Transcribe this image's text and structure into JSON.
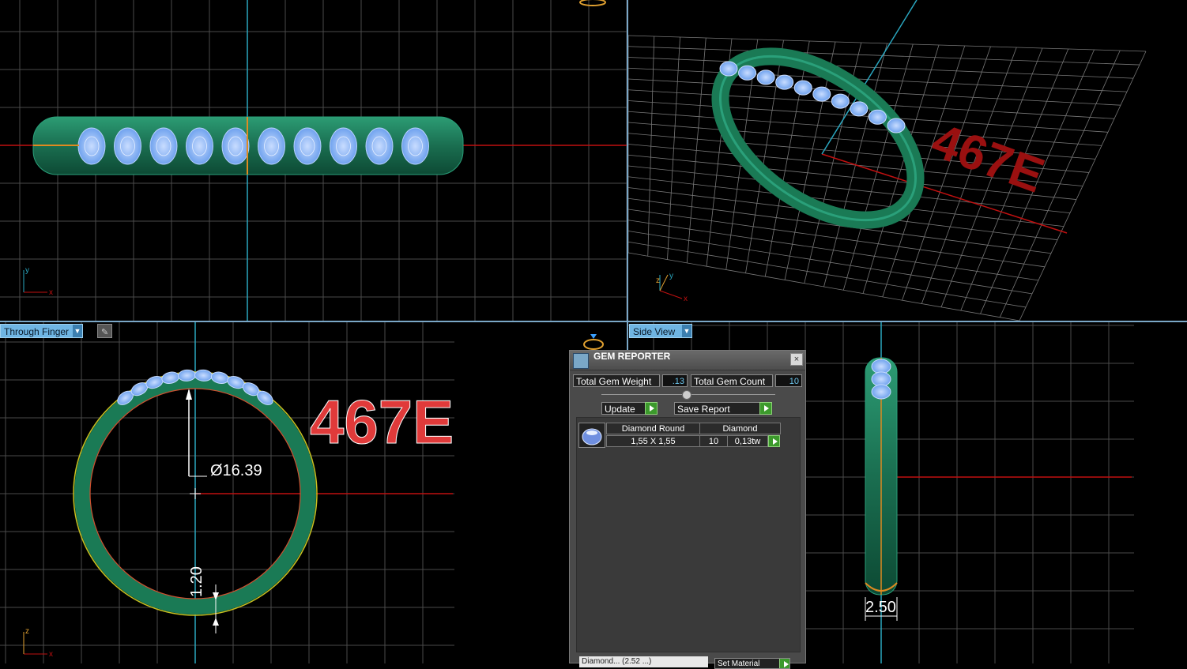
{
  "viewports": {
    "top_left": {
      "axis_x": "x",
      "axis_y": "y"
    },
    "top_right": {
      "axis_x": "x",
      "axis_y": "y",
      "axis_z": "z",
      "engraving": "467E"
    },
    "bottom_left": {
      "label": "Through Finger",
      "engraving": "467E",
      "diameter": "Ø16.39",
      "thickness": "1.20",
      "axis_x": "x",
      "axis_y": "z"
    },
    "bottom_right": {
      "label": "Side View",
      "width_dim": "2.50"
    }
  },
  "gem_reporter": {
    "title": "GEM REPORTER",
    "close": "×",
    "total_weight_label": "Total Gem Weight",
    "total_weight_value": ".13",
    "total_count_label": "Total Gem Count",
    "total_count_value": "10",
    "update_label": "Update",
    "save_report_label": "Save Report",
    "row": {
      "shape": "Diamond Round",
      "material": "Diamond",
      "size": "1,55 X 1,55",
      "count": "10",
      "weight": "0,13tw"
    },
    "bottom_left": "Diamond... (2.52 ...)",
    "bottom_right": "Set Material"
  },
  "colors": {
    "band": "#1d7a5a",
    "gem": "#8ab8ff",
    "engrave_red": "#e03a3a",
    "axis_red": "#c01010",
    "axis_blue": "#2aa7c0"
  }
}
